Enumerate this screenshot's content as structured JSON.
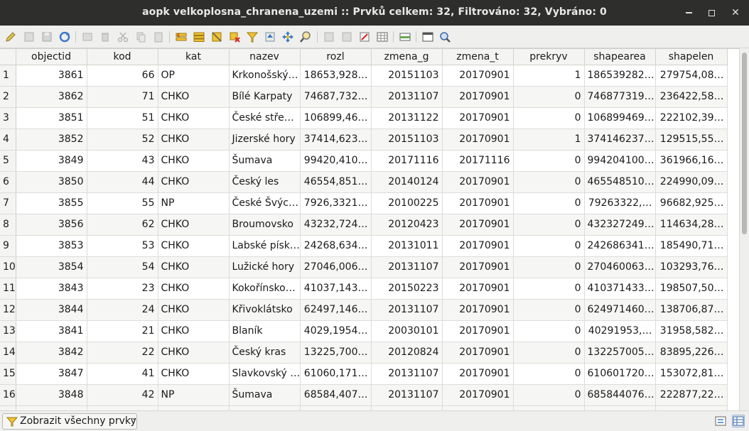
{
  "window": {
    "title": "aopk velkoplosna_chranena_uzemi :: Prvků celkem: 32, Filtrováno: 32, Vybráno: 0"
  },
  "toolbar": {
    "icons": [
      "pencil-icon",
      "multi-edit-icon",
      "save-icon",
      "reload-icon",
      "add-feature-icon",
      "delete-icon",
      "cut-icon",
      "copy-icon",
      "paste-icon",
      "select-expression-icon",
      "select-all-icon",
      "invert-selection-icon",
      "deselect-icon",
      "filter-icon",
      "move-selection-top-icon",
      "pan-to-selection-icon",
      "zoom-to-selection-icon",
      "new-field-icon",
      "delete-field-icon",
      "field-calculator-icon",
      "conditional-formatting-icon",
      "dock-icon",
      "actions-icon",
      "zoom-icon"
    ]
  },
  "table": {
    "columns": [
      "objectid",
      "kod",
      "kat",
      "nazev",
      "rozl",
      "zmena_g",
      "zmena_t",
      "prekryv",
      "shapearea",
      "shapelen"
    ],
    "rows": [
      [
        "1",
        "3861",
        "66",
        "OP",
        "Krkonošský…",
        "18653,928…",
        "20151103",
        "20170901",
        "1",
        "186539282…",
        "279754,08…"
      ],
      [
        "2",
        "3862",
        "71",
        "CHKO",
        "Bílé Karpaty",
        "74687,732…",
        "20131107",
        "20170901",
        "0",
        "746877319…",
        "236422,58…"
      ],
      [
        "3",
        "3851",
        "51",
        "CHKO",
        "České stře…",
        "106899,46…",
        "20131122",
        "20170901",
        "0",
        "106899469…",
        "222102,39…"
      ],
      [
        "4",
        "3852",
        "52",
        "CHKO",
        "Jizerské hory",
        "37414,623…",
        "20151103",
        "20170901",
        "1",
        "374146237…",
        "129515,55…"
      ],
      [
        "5",
        "3849",
        "43",
        "CHKO",
        "Šumava",
        "99420,410…",
        "20171116",
        "20171116",
        "0",
        "994204100…",
        "361966,16…"
      ],
      [
        "6",
        "3850",
        "44",
        "CHKO",
        "Český les",
        "46554,851…",
        "20140124",
        "20170901",
        "0",
        "465548510…",
        "224990,09…"
      ],
      [
        "7",
        "3855",
        "55",
        "NP",
        "České Švýc…",
        "7926,3321…",
        "20100225",
        "20170901",
        "0",
        "79263322,…",
        "96682,925…"
      ],
      [
        "8",
        "3856",
        "62",
        "CHKO",
        "Broumovsko",
        "43232,724…",
        "20120423",
        "20170901",
        "0",
        "432327249…",
        "114634,28…"
      ],
      [
        "9",
        "3853",
        "53",
        "CHKO",
        "Labské písk…",
        "24268,634…",
        "20131011",
        "20170901",
        "0",
        "242686341…",
        "185490,71…"
      ],
      [
        "10",
        "3854",
        "54",
        "CHKO",
        "Lužické hory",
        "27046,006…",
        "20131107",
        "20170901",
        "0",
        "270460063…",
        "103293,76…"
      ],
      [
        "11",
        "3843",
        "23",
        "CHKO",
        "Kokořínsko…",
        "41037,143…",
        "20150223",
        "20170901",
        "0",
        "410371433…",
        "198507,50…"
      ],
      [
        "12",
        "3844",
        "24",
        "CHKO",
        "Křivoklátsko",
        "62497,146…",
        "20131107",
        "20170901",
        "0",
        "624971460…",
        "138706,87…"
      ],
      [
        "13",
        "3841",
        "21",
        "CHKO",
        "Blaník",
        "4029,1954…",
        "20030101",
        "20170901",
        "0",
        "40291953,…",
        "31958,582…"
      ],
      [
        "14",
        "3842",
        "22",
        "CHKO",
        "Český kras",
        "13225,700…",
        "20120824",
        "20170901",
        "0",
        "132257005…",
        "83895,226…"
      ],
      [
        "15",
        "3847",
        "41",
        "CHKO",
        "Slavkovský …",
        "61060,171…",
        "20131107",
        "20170901",
        "0",
        "610601720…",
        "153072,81…"
      ],
      [
        "16",
        "3848",
        "42",
        "NP",
        "Šumava",
        "68584,407…",
        "20131107",
        "20170901",
        "0",
        "685844076…",
        "222877,22…"
      ]
    ]
  },
  "bottombar": {
    "filter_label": "Zobrazit všechny prvky"
  }
}
